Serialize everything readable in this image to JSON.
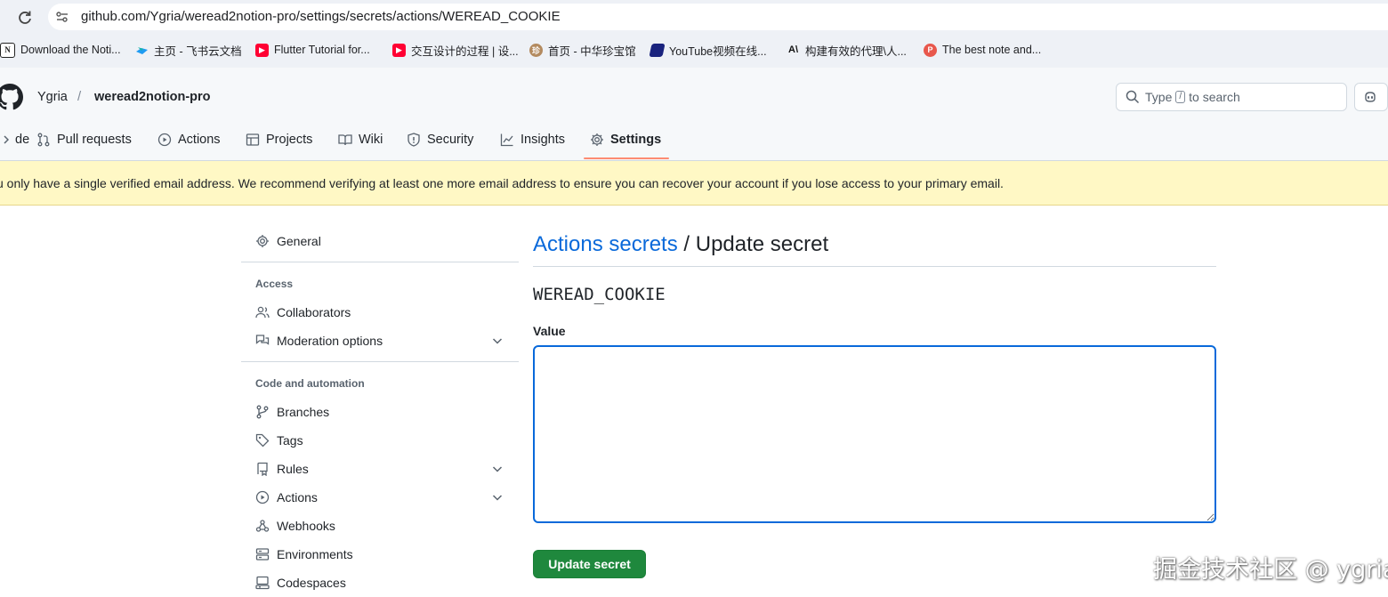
{
  "browser": {
    "url": "github.com/Ygria/weread2notion-pro/settings/secrets/actions/WEREAD_COOKIE",
    "bookmarks": [
      {
        "label": "Download the Noti...",
        "icon": "notion-icon"
      },
      {
        "label": "主页 - 飞书云文档",
        "icon": "feishu-icon"
      },
      {
        "label": "Flutter Tutorial for...",
        "icon": "youtube-icon"
      },
      {
        "label": "交互设计的过程 | 设...",
        "icon": "youtube-icon"
      },
      {
        "label": "首页 - 中华珍宝馆",
        "icon": "museum-icon"
      },
      {
        "label": "YouTube视频在线...",
        "icon": "flag-icon"
      },
      {
        "label": "构建有效的代理\\人...",
        "icon": "anthropic-icon"
      },
      {
        "label": "The best note and...",
        "icon": "p-icon"
      }
    ]
  },
  "header": {
    "owner": "Ygria",
    "separator": "/",
    "repo": "weread2notion-pro",
    "search": {
      "prefix": "Type",
      "key": "/",
      "suffix": "to search"
    }
  },
  "tabs": [
    {
      "label": "de",
      "icon": "code-icon"
    },
    {
      "label": "Pull requests",
      "icon": "git-pull-request-icon"
    },
    {
      "label": "Actions",
      "icon": "play-icon"
    },
    {
      "label": "Projects",
      "icon": "table-icon"
    },
    {
      "label": "Wiki",
      "icon": "book-icon"
    },
    {
      "label": "Security",
      "icon": "shield-icon"
    },
    {
      "label": "Insights",
      "icon": "graph-icon"
    },
    {
      "label": "Settings",
      "icon": "gear-icon",
      "active": true
    }
  ],
  "flash": {
    "text": "u only have a single verified email address. We recommend verifying at least one more email address to ensure you can recover your account if you lose access to your primary email."
  },
  "sidebar": {
    "general": "General",
    "sections": [
      {
        "heading": "Access",
        "items": [
          {
            "label": "Collaborators",
            "icon": "people-icon"
          },
          {
            "label": "Moderation options",
            "icon": "comment-discussion-icon",
            "expandable": true
          }
        ]
      },
      {
        "heading": "Code and automation",
        "items": [
          {
            "label": "Branches",
            "icon": "git-branch-icon"
          },
          {
            "label": "Tags",
            "icon": "tag-icon"
          },
          {
            "label": "Rules",
            "icon": "repo-push-icon",
            "expandable": true
          },
          {
            "label": "Actions",
            "icon": "play-icon",
            "expandable": true
          },
          {
            "label": "Webhooks",
            "icon": "webhook-icon"
          },
          {
            "label": "Environments",
            "icon": "server-icon"
          },
          {
            "label": "Codespaces",
            "icon": "codespaces-icon"
          }
        ]
      }
    ]
  },
  "main": {
    "breadcrumb_link": "Actions secrets",
    "breadcrumb_sep": " / ",
    "title": "Update secret",
    "secret_name": "WEREAD_COOKIE",
    "value_label": "Value",
    "value": "",
    "submit_label": "Update secret"
  },
  "watermark": "掘金技术社区 @ ygria",
  "colors": {
    "accent": "#0969da",
    "primary_button": "#1f883d",
    "flash_bg": "#fff8c5",
    "tab_underline": "#fd8c73"
  }
}
